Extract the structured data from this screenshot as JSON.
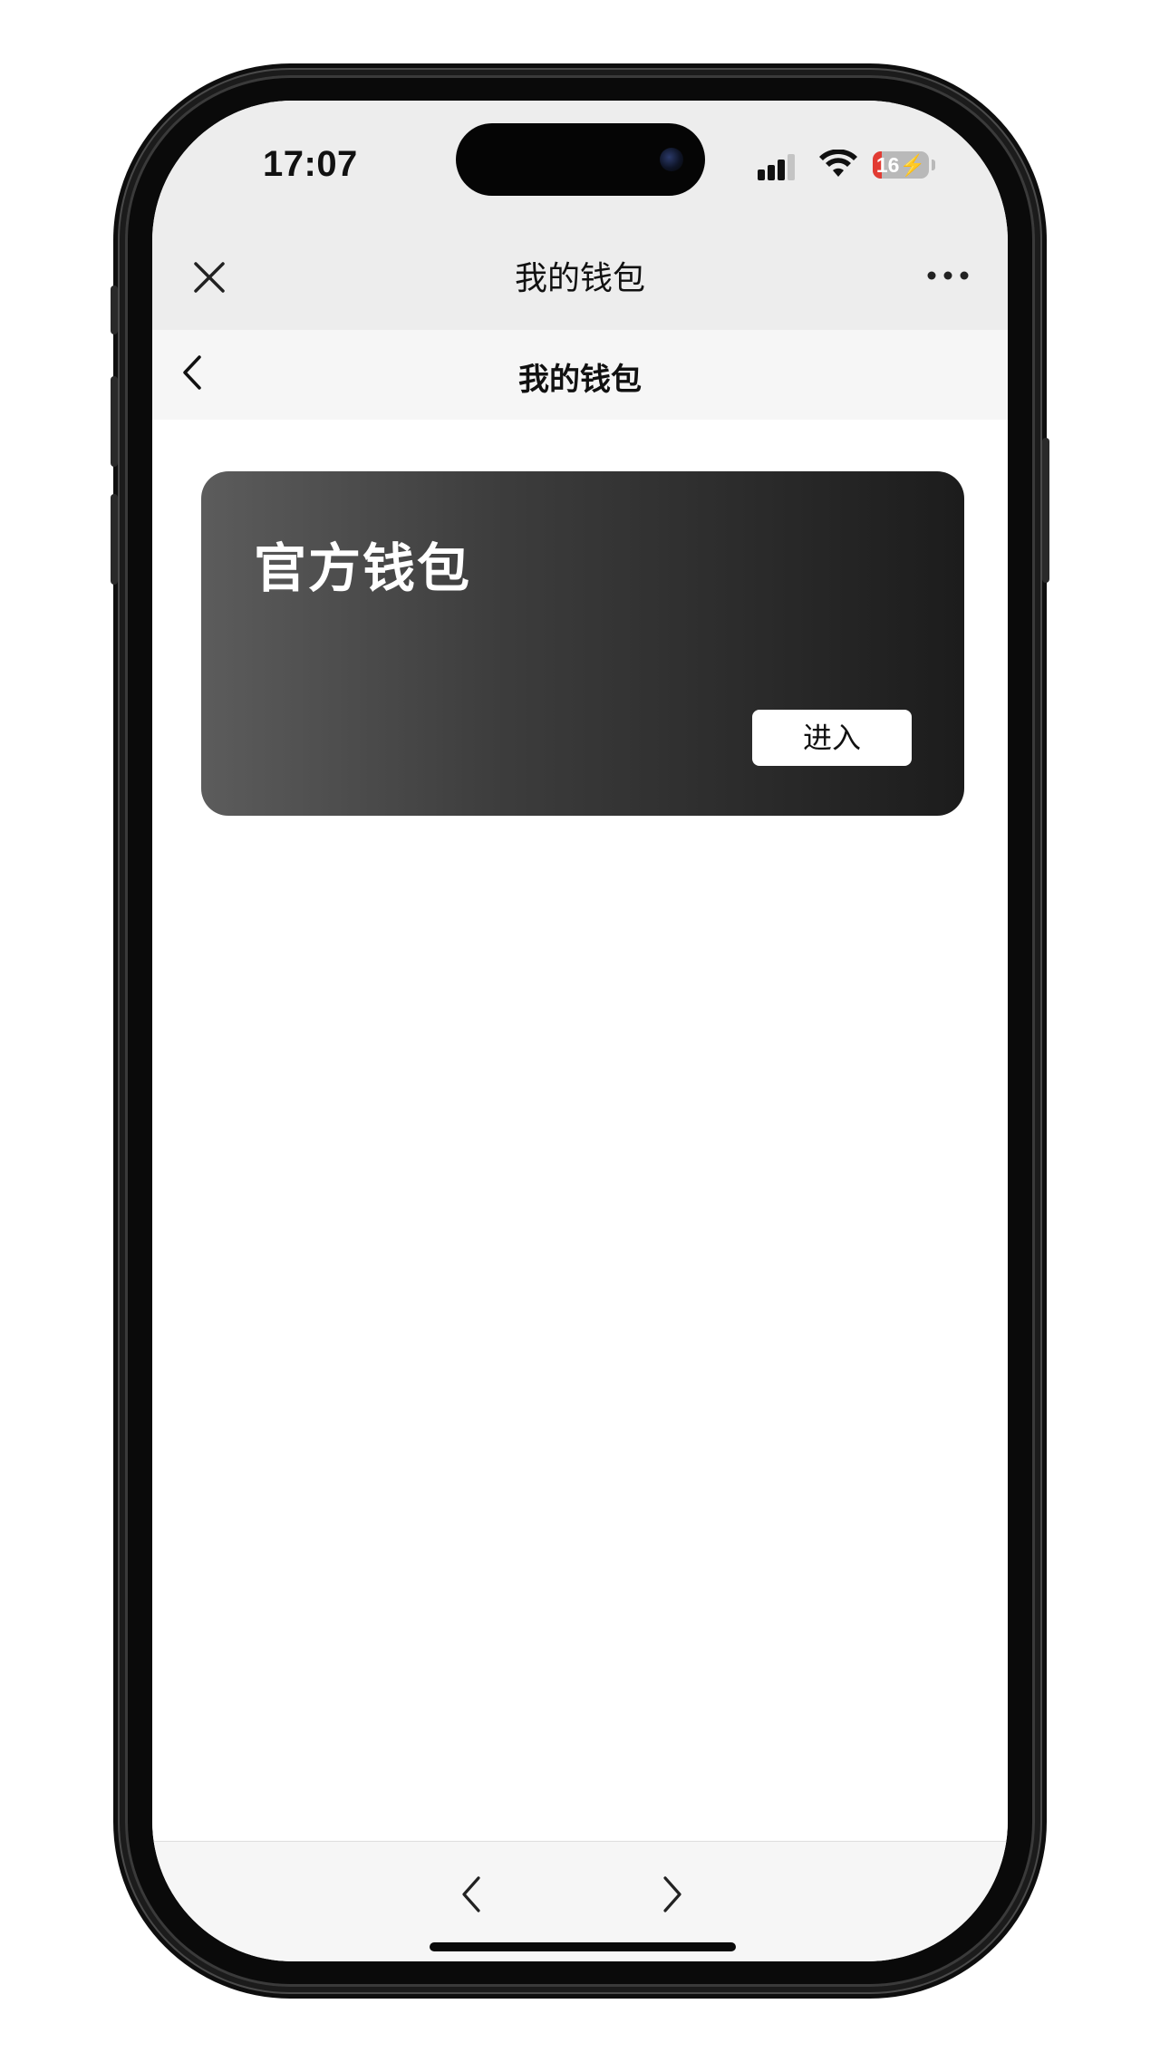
{
  "status_bar": {
    "time": "17:07",
    "battery_level": "16",
    "battery_fraction": 0.16,
    "battery_color": "#e23b33",
    "icons": [
      "cellular-signal-icon",
      "wifi-icon",
      "battery-charging-icon"
    ]
  },
  "top_nav": {
    "title": "我的钱包",
    "close_icon": "close-icon",
    "more_icon": "more-icon"
  },
  "page_header": {
    "title": "我的钱包",
    "back_icon": "chevron-left-icon"
  },
  "wallet_card": {
    "title": "官方钱包",
    "button_label": "进入",
    "gradient_colors": [
      "#5c5c5c",
      "#1c1c1c"
    ]
  },
  "bottom_bar": {
    "back_icon": "chevron-left-icon",
    "forward_icon": "chevron-right-icon"
  }
}
